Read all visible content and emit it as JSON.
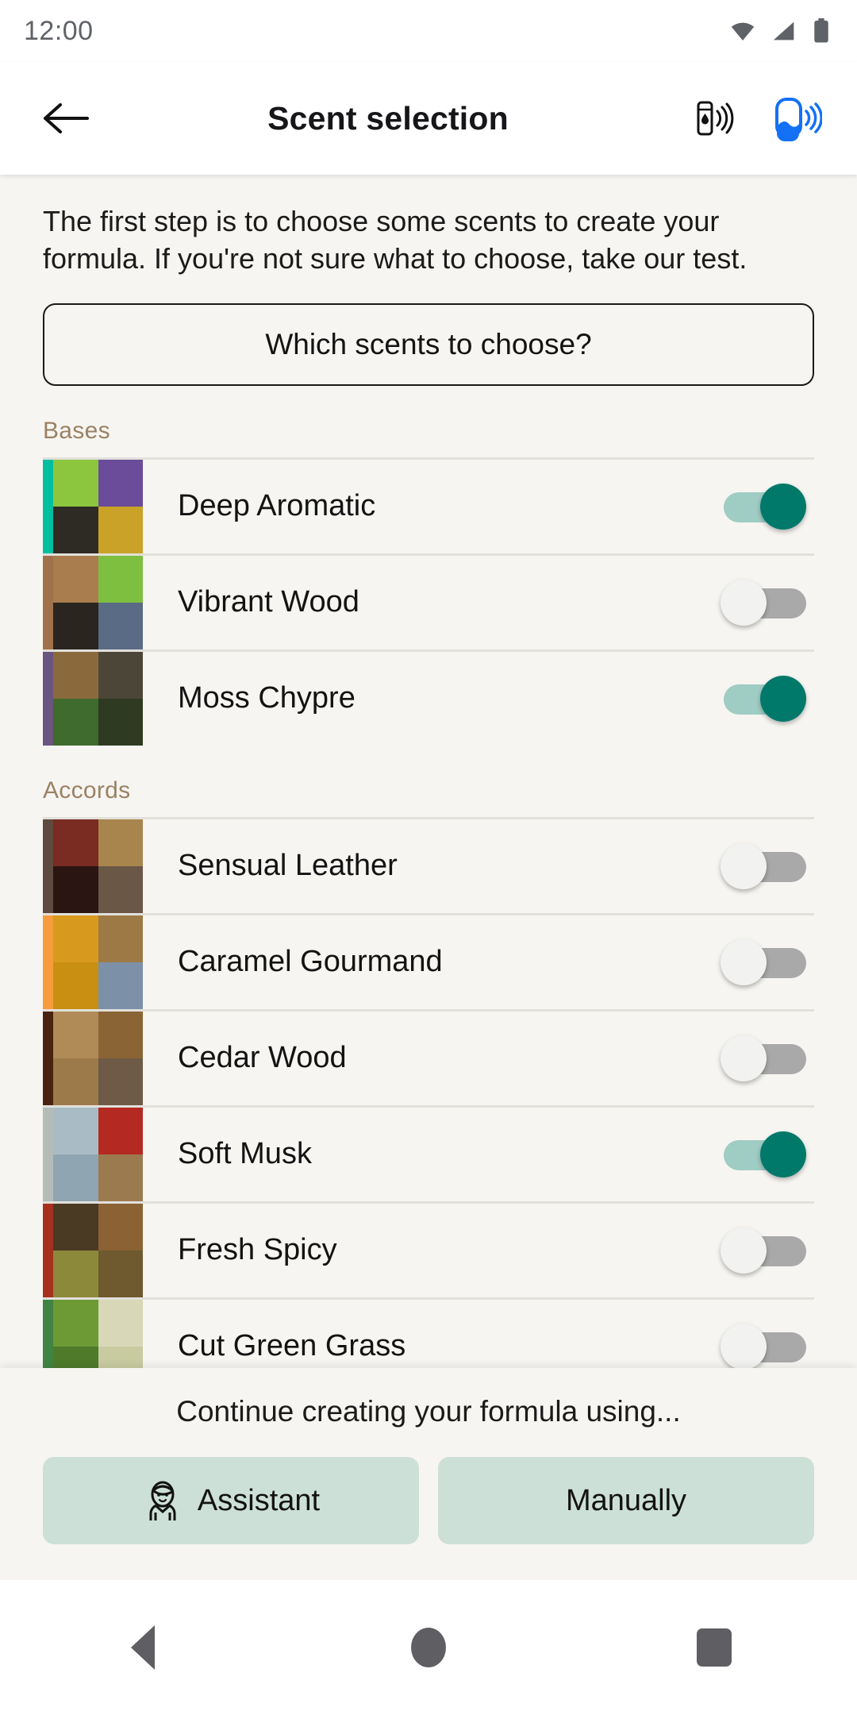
{
  "status_bar": {
    "time": "12:00",
    "icons": [
      "wifi-icon",
      "cellular-signal-icon",
      "battery-icon"
    ]
  },
  "app_bar": {
    "back_icon": "back-arrow-icon",
    "title": "Scent selection",
    "actions": [
      {
        "icon": "device-pen-wireless-icon",
        "color": "#111111"
      },
      {
        "icon": "device-diffuser-wireless-icon",
        "color": "#1470F5"
      }
    ]
  },
  "main": {
    "intro": "The first step is to choose some scents to create your formula. If you're not sure what to choose, take our test.",
    "cta_label": "Which scents to choose?",
    "sections": [
      {
        "title": "Bases",
        "items": [
          {
            "label": "Deep Aromatic",
            "enabled": true,
            "accent": "#00BFA0",
            "tiles": [
              "#8CC63F",
              "#6B4C9A",
              "#2E2A24",
              "#C9A227"
            ]
          },
          {
            "label": "Vibrant Wood",
            "enabled": false,
            "accent": "#A0714A",
            "tiles": [
              "#A97D4E",
              "#7FBF3F",
              "#2B2520",
              "#5A6B86"
            ]
          },
          {
            "label": "Moss Chypre",
            "enabled": true,
            "accent": "#6A5480",
            "tiles": [
              "#8A6A3C",
              "#4C4638",
              "#3F6B2E",
              "#2E3A22"
            ]
          }
        ]
      },
      {
        "title": "Accords",
        "items": [
          {
            "label": "Sensual Leather",
            "enabled": false,
            "accent": "#5E4A3E",
            "tiles": [
              "#7A2B22",
              "#A9854E",
              "#2A1512",
              "#6B5746"
            ]
          },
          {
            "label": "Caramel Gourmand",
            "enabled": false,
            "accent": "#F89B3C",
            "tiles": [
              "#D79A1E",
              "#9D7A45",
              "#C98F12",
              "#7C90A8"
            ]
          },
          {
            "label": "Cedar Wood",
            "enabled": false,
            "accent": "#4A2310",
            "tiles": [
              "#B08B58",
              "#8A6434",
              "#9C7A4A",
              "#6E5A46"
            ]
          },
          {
            "label": "Soft Musk",
            "enabled": true,
            "accent": "#B4BCB8",
            "tiles": [
              "#A9BCC6",
              "#B42A22",
              "#8FA5B2",
              "#9C7A50"
            ]
          },
          {
            "label": "Fresh Spicy",
            "enabled": false,
            "accent": "#A72F1E",
            "tiles": [
              "#4A3A24",
              "#8A6234",
              "#8C8A3A",
              "#6E5A2E"
            ]
          },
          {
            "label": "Cut Green Grass",
            "enabled": false,
            "accent": "#3F8442",
            "tiles": [
              "#6D9A34",
              "#D8D8B8",
              "#4E7A2A",
              "#C8CBA0"
            ]
          }
        ]
      }
    ]
  },
  "bottom_panel": {
    "title": "Continue creating your formula using...",
    "buttons": [
      {
        "label": "Assistant",
        "icon": "assistant-person-icon"
      },
      {
        "label": "Manually",
        "icon": ""
      }
    ]
  },
  "nav_bar": {
    "back_icon": "nav-back-icon",
    "home_icon": "nav-home-icon",
    "recents_icon": "nav-recents-icon"
  }
}
